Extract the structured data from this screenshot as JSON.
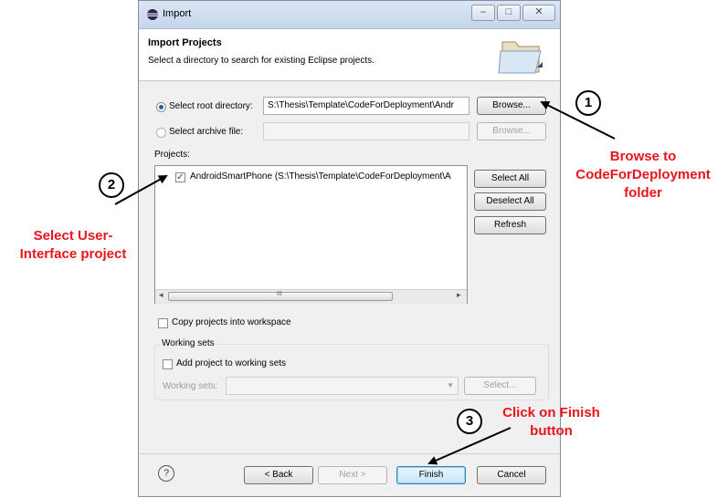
{
  "window": {
    "title": "Import",
    "controls": {
      "minimize": "–",
      "maximize": "□",
      "close": "✕"
    }
  },
  "header": {
    "title": "Import Projects",
    "description": "Select a directory to search for existing Eclipse projects."
  },
  "source": {
    "root_label": "Select root directory:",
    "root_value": "S:\\Thesis\\Template\\CodeForDeployment\\Andr",
    "root_selected": true,
    "archive_label": "Select archive file:",
    "archive_value": "",
    "browse_label": "Browse...",
    "browse_archive_label": "Browse..."
  },
  "projects": {
    "label": "Projects:",
    "items": [
      {
        "label": "AndroidSmartPhone (S:\\Thesis\\Template\\CodeForDeployment\\A",
        "checked": true
      }
    ],
    "select_all": "Select All",
    "deselect_all": "Deselect All",
    "refresh": "Refresh",
    "scroll_mid": "III"
  },
  "options": {
    "copy_label": "Copy projects into workspace",
    "working_sets_group": "Working sets",
    "add_label": "Add project to working sets",
    "working_sets_label": "Working sets:",
    "working_sets_value": "",
    "select_label": "Select..."
  },
  "footer": {
    "help": "?",
    "back": "< Back",
    "next": "Next >",
    "finish": "Finish",
    "cancel": "Cancel"
  },
  "annotations": {
    "step1": {
      "number": "1",
      "line1": "Browse to",
      "line2": "CodeForDeployment",
      "line3": "folder"
    },
    "step2": {
      "number": "2",
      "line1": "Select User-",
      "line2": "Interface project"
    },
    "step3": {
      "number": "3",
      "line1": "Click on Finish",
      "line2": "button"
    }
  },
  "colors": {
    "annotation_red": "#e8141b",
    "title_bar": "#c5d5ea",
    "window_bg": "#f0f0f0"
  }
}
